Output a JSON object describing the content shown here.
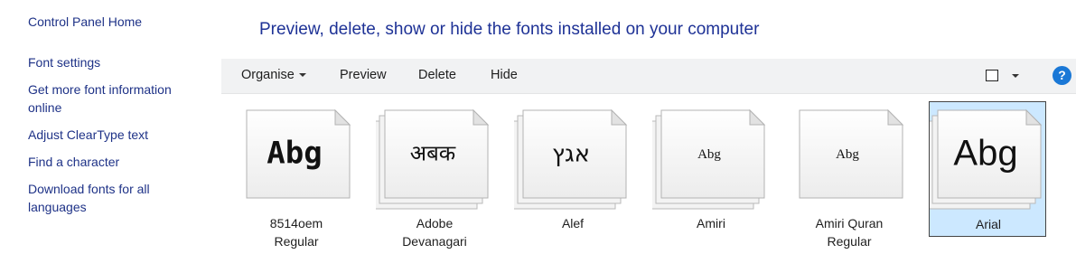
{
  "nav": {
    "home": "Control Panel Home",
    "links": [
      "Font settings",
      "Get more font information online",
      "Adjust ClearType text",
      "Find a character",
      "Download fonts for all languages"
    ]
  },
  "header": {
    "title": "Preview, delete, show or hide the fonts installed on your computer"
  },
  "toolbar": {
    "organise": "Organise",
    "preview": "Preview",
    "delete": "Delete",
    "hide": "Hide",
    "help": "?"
  },
  "fonts": [
    {
      "name_line1": "8514oem",
      "name_line2": "Regular",
      "sample": "Abg",
      "stacked": false,
      "selected": false
    },
    {
      "name_line1": "Adobe",
      "name_line2": "Devanagari",
      "sample": "अबक",
      "stacked": true,
      "selected": false
    },
    {
      "name_line1": "Alef",
      "name_line2": "",
      "sample": "אגץ",
      "stacked": true,
      "selected": false
    },
    {
      "name_line1": "Amiri",
      "name_line2": "",
      "sample": "Abg",
      "stacked": true,
      "selected": false
    },
    {
      "name_line1": "Amiri Quran",
      "name_line2": "Regular",
      "sample": "Abg",
      "stacked": false,
      "selected": false
    },
    {
      "name_line1": "Arial",
      "name_line2": "",
      "sample": "Abg",
      "stacked": true,
      "selected": true
    }
  ],
  "colors": {
    "link": "#1e3287",
    "title": "#1e3296",
    "toolbar_bg": "#f1f2f3",
    "selection": "#cce8ff",
    "help": "#1a78d6"
  }
}
